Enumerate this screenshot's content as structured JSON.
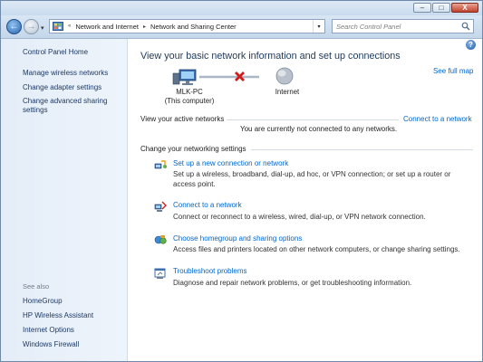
{
  "window": {
    "buttons": {
      "minimize": "–",
      "maximize": "□",
      "close": "X"
    }
  },
  "navigation": {
    "back_glyph": "←",
    "forward_glyph": "→",
    "recent_glyph": "▾",
    "overflow_glyph": "«",
    "breadcrumb": [
      "Network and Internet",
      "Network and Sharing Center"
    ],
    "separator": "▸",
    "dropdown_glyph": "▾",
    "address_icon": "control-panel-icon",
    "search": {
      "placeholder": "Search Control Panel",
      "value": ""
    }
  },
  "sidebar": {
    "home": "Control Panel Home",
    "items": [
      "Manage wireless networks",
      "Change adapter settings",
      "Change advanced sharing settings"
    ],
    "see_also_label": "See also",
    "see_also": [
      "HomeGroup",
      "HP Wireless Assistant",
      "Internet Options",
      "Windows Firewall"
    ]
  },
  "main": {
    "help_glyph": "?",
    "title": "View your basic network information and set up connections",
    "see_full_map": "See full map",
    "map": {
      "computer_name": "MLK-PC",
      "computer_sub": "(This computer)",
      "internet_label": "Internet",
      "status": "disconnected",
      "status_icon": "red-x-icon"
    },
    "active_networks": {
      "label": "View your active networks",
      "connect_link": "Connect to a network",
      "status_text": "You are currently not connected to any networks."
    },
    "change_settings_label": "Change your networking settings",
    "tasks": [
      {
        "icon": "setup-connection-icon",
        "title": "Set up a new connection or network",
        "description": "Set up a wireless, broadband, dial-up, ad hoc, or VPN connection; or set up a router or access point."
      },
      {
        "icon": "connect-network-icon",
        "title": "Connect to a network",
        "description": "Connect or reconnect to a wireless, wired, dial-up, or VPN network connection."
      },
      {
        "icon": "homegroup-icon",
        "title": "Choose homegroup and sharing options",
        "description": "Access files and printers located on other network computers, or change sharing settings."
      },
      {
        "icon": "troubleshoot-icon",
        "title": "Troubleshoot problems",
        "description": "Diagnose and repair network problems, or get troubleshooting information."
      }
    ]
  },
  "colors": {
    "link": "#0066cc",
    "title": "#1e395b",
    "sidebar_link": "#1e3a64",
    "sidebar_bg": "#e4edf8",
    "error_x": "#d11c1c"
  }
}
